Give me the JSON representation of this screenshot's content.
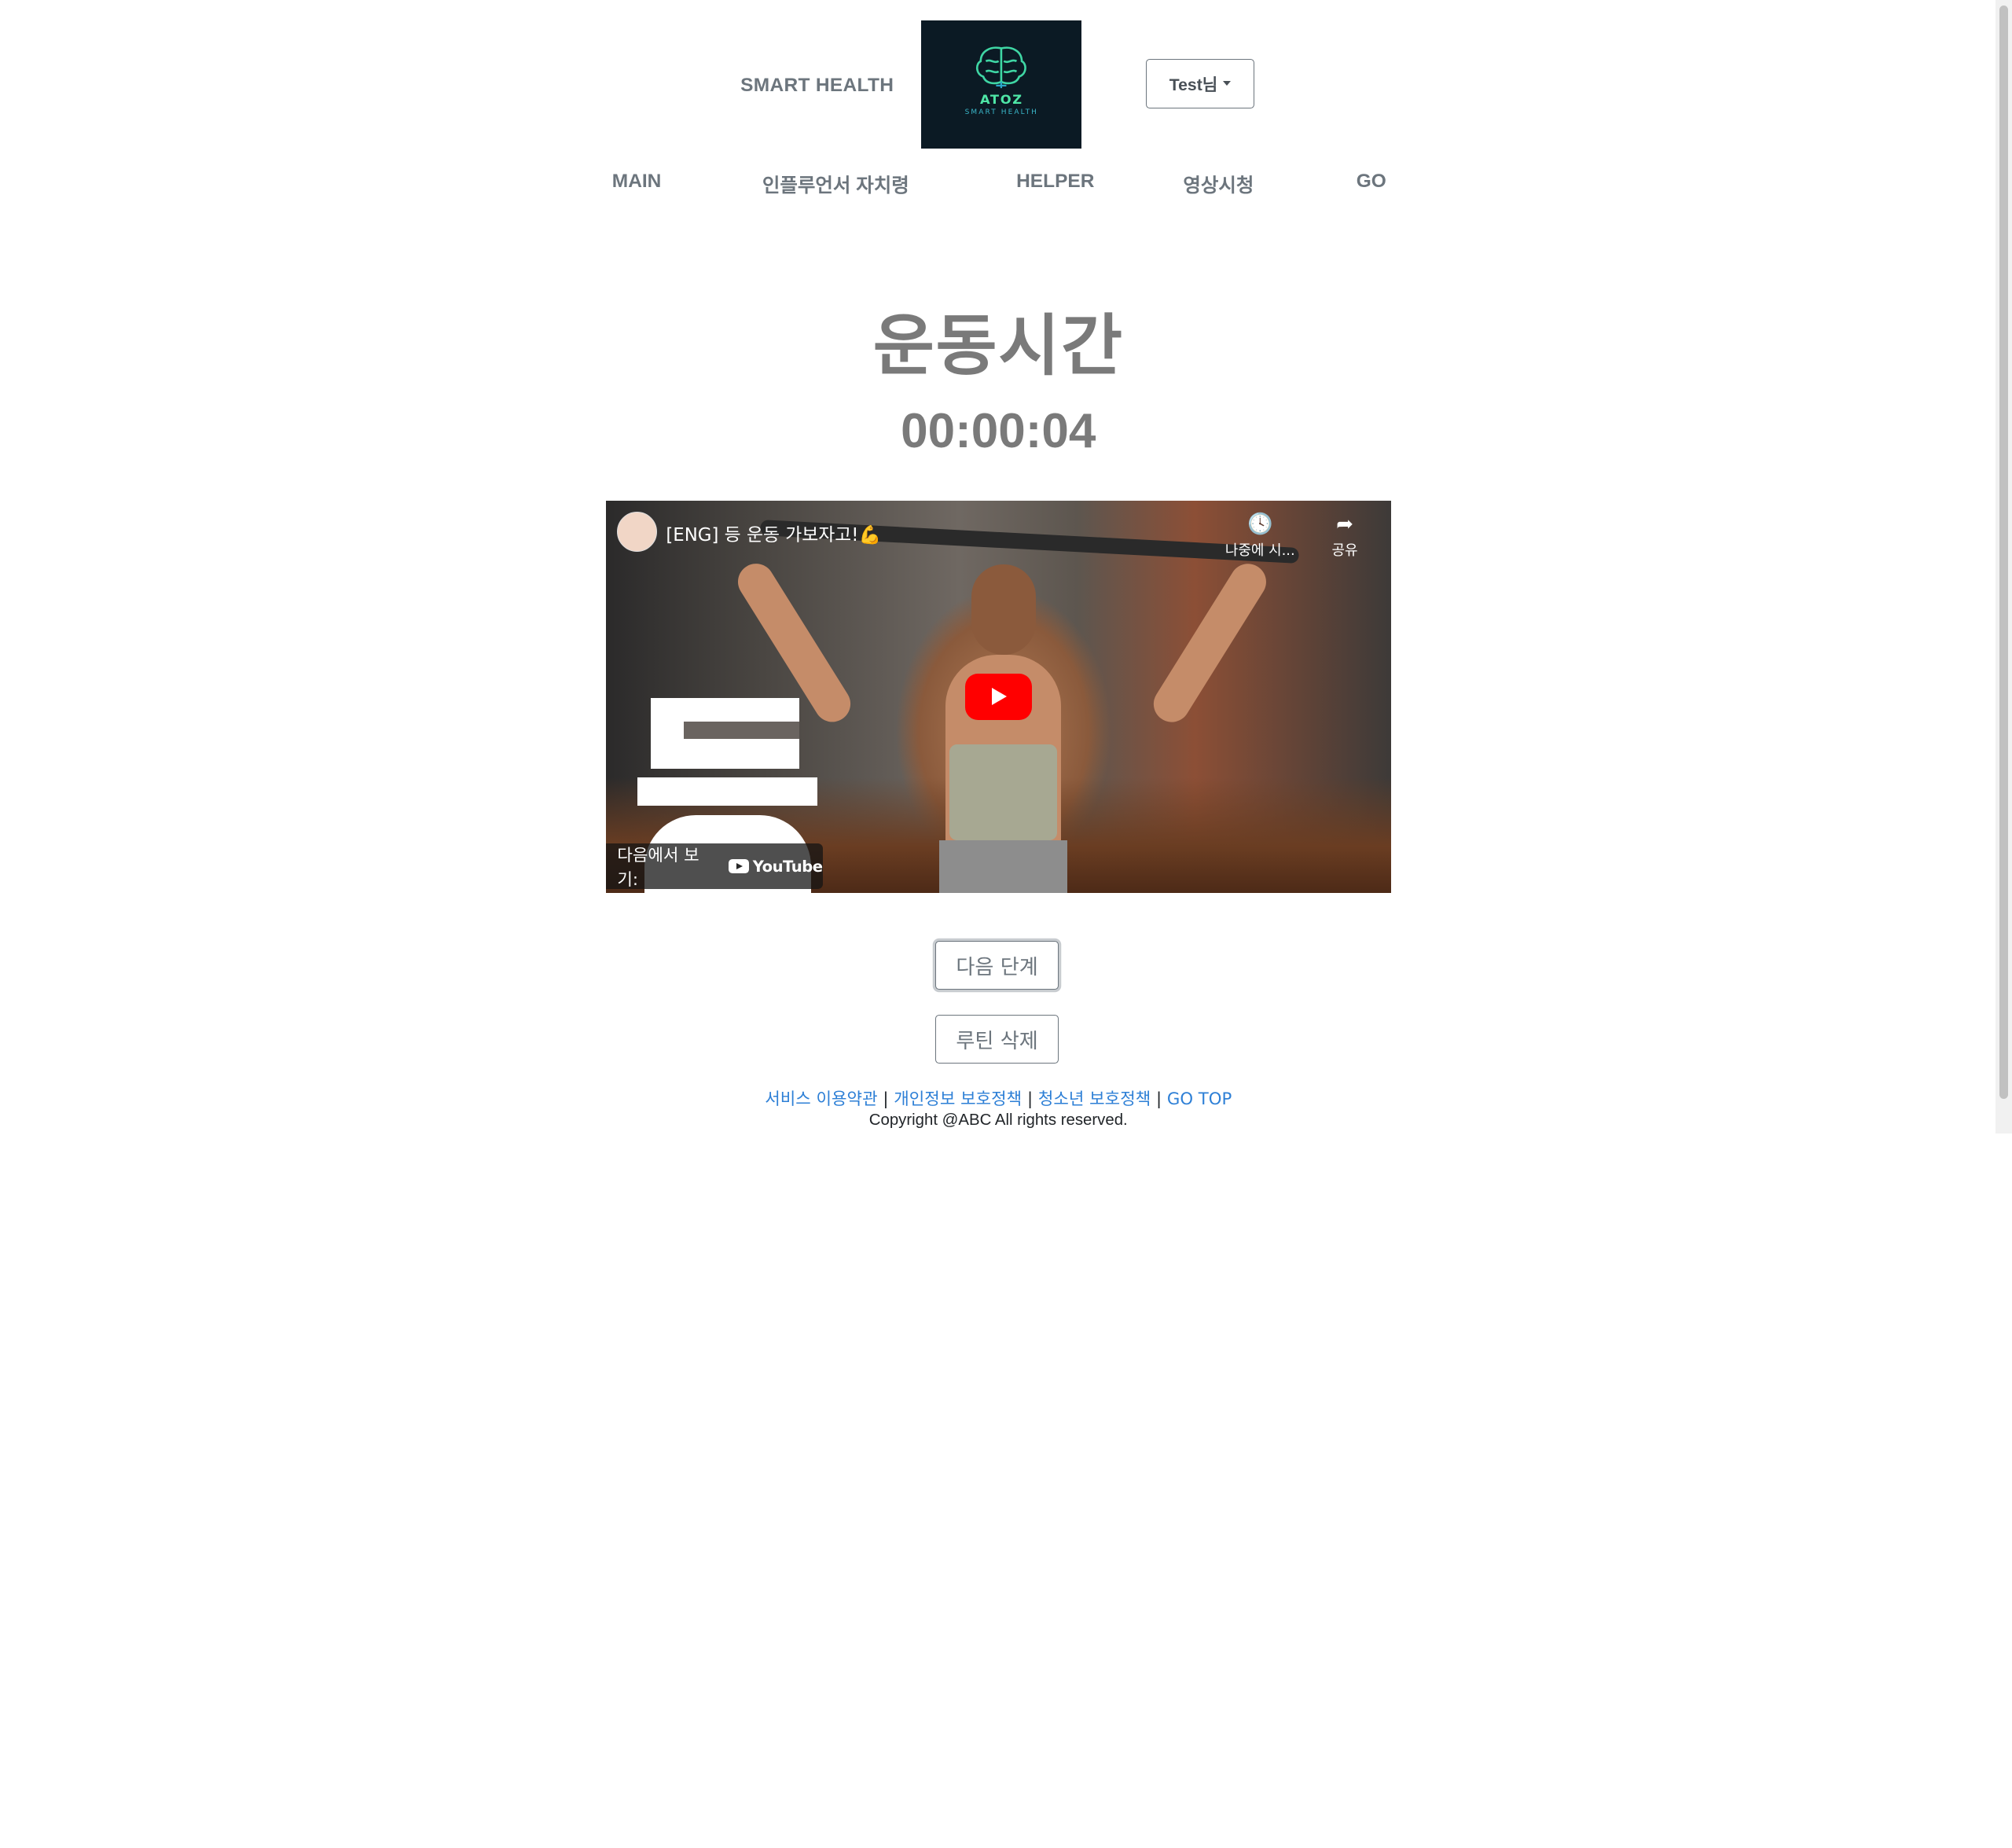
{
  "header": {
    "brand_text": "SMART HEALTH",
    "logo": {
      "title": "ATOZ",
      "subtitle": "SMART HEALTH"
    },
    "user_menu_label": "Test님"
  },
  "nav": {
    "items": [
      {
        "label": "MAIN"
      },
      {
        "label": "인플루언서 자치령"
      },
      {
        "label": "HELPER"
      },
      {
        "label": "영상시청"
      },
      {
        "label": "GO"
      }
    ]
  },
  "main": {
    "title": "운동시간",
    "timer": "00:00:04"
  },
  "video": {
    "title": "[ENG] 등 운동 가보자고!💪",
    "watch_later": "나중에 시...",
    "share": "공유",
    "watch_on": "다음에서 보기:",
    "youtube": "YouTube",
    "brand_red": "#ff0000"
  },
  "buttons": {
    "next_step": "다음 단계",
    "delete_routine": "루틴 삭제"
  },
  "footer": {
    "links": [
      {
        "label": "서비스 이용약관"
      },
      {
        "label": "개인정보 보호정책"
      },
      {
        "label": "청소년 보호정책"
      },
      {
        "label": "GO TOP"
      }
    ],
    "separator": "|",
    "copyright": "Copyright @ABC All rights reserved.",
    "link_color": "#2d7fd6"
  }
}
